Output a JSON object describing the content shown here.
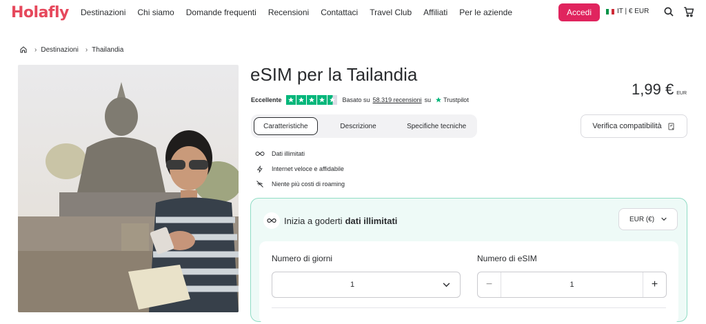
{
  "brand": {
    "logo": "Holafly",
    "accent": "#e0245e"
  },
  "nav": {
    "items": [
      "Destinazioni",
      "Chi siamo",
      "Domande frequenti",
      "Recensioni",
      "Contattaci",
      "Travel Club",
      "Affiliati",
      "Per le aziende"
    ]
  },
  "header": {
    "login_label": "Accedi",
    "locale_label": "IT | € EUR",
    "icons": [
      "italy-flag-icon",
      "search-icon",
      "cart-icon"
    ]
  },
  "breadcrumb": {
    "items": [
      "Destinazioni",
      "Thailandia"
    ]
  },
  "product": {
    "title": "eSIM per la Tailandia",
    "price": "1,99 €",
    "currency": "EUR",
    "rating_label": "Eccellente",
    "stars": 4.5,
    "based_on": "Basato su",
    "reviews_link": "58.319 recensioni",
    "on_label": "su",
    "trustpilot": "Trustpilot"
  },
  "tabs": [
    "Caratteristiche",
    "Descrizione",
    "Specifiche tecniche"
  ],
  "verify_label": "Verifica compatibilità",
  "features": [
    {
      "icon": "infinity-icon",
      "label": "Dati illimitati"
    },
    {
      "icon": "bolt-icon",
      "label": "Internet veloce e affidabile"
    },
    {
      "icon": "no-roaming-icon",
      "label": "Niente più costi di roaming"
    }
  ],
  "plan": {
    "heading_prefix": "Inizia a goderti",
    "heading_bold": "dati illimitati",
    "currency_select": "EUR (€)",
    "days_label": "Numero di giorni",
    "days_value": "1",
    "esim_label": "Numero di eSIM",
    "esim_value": "1"
  }
}
